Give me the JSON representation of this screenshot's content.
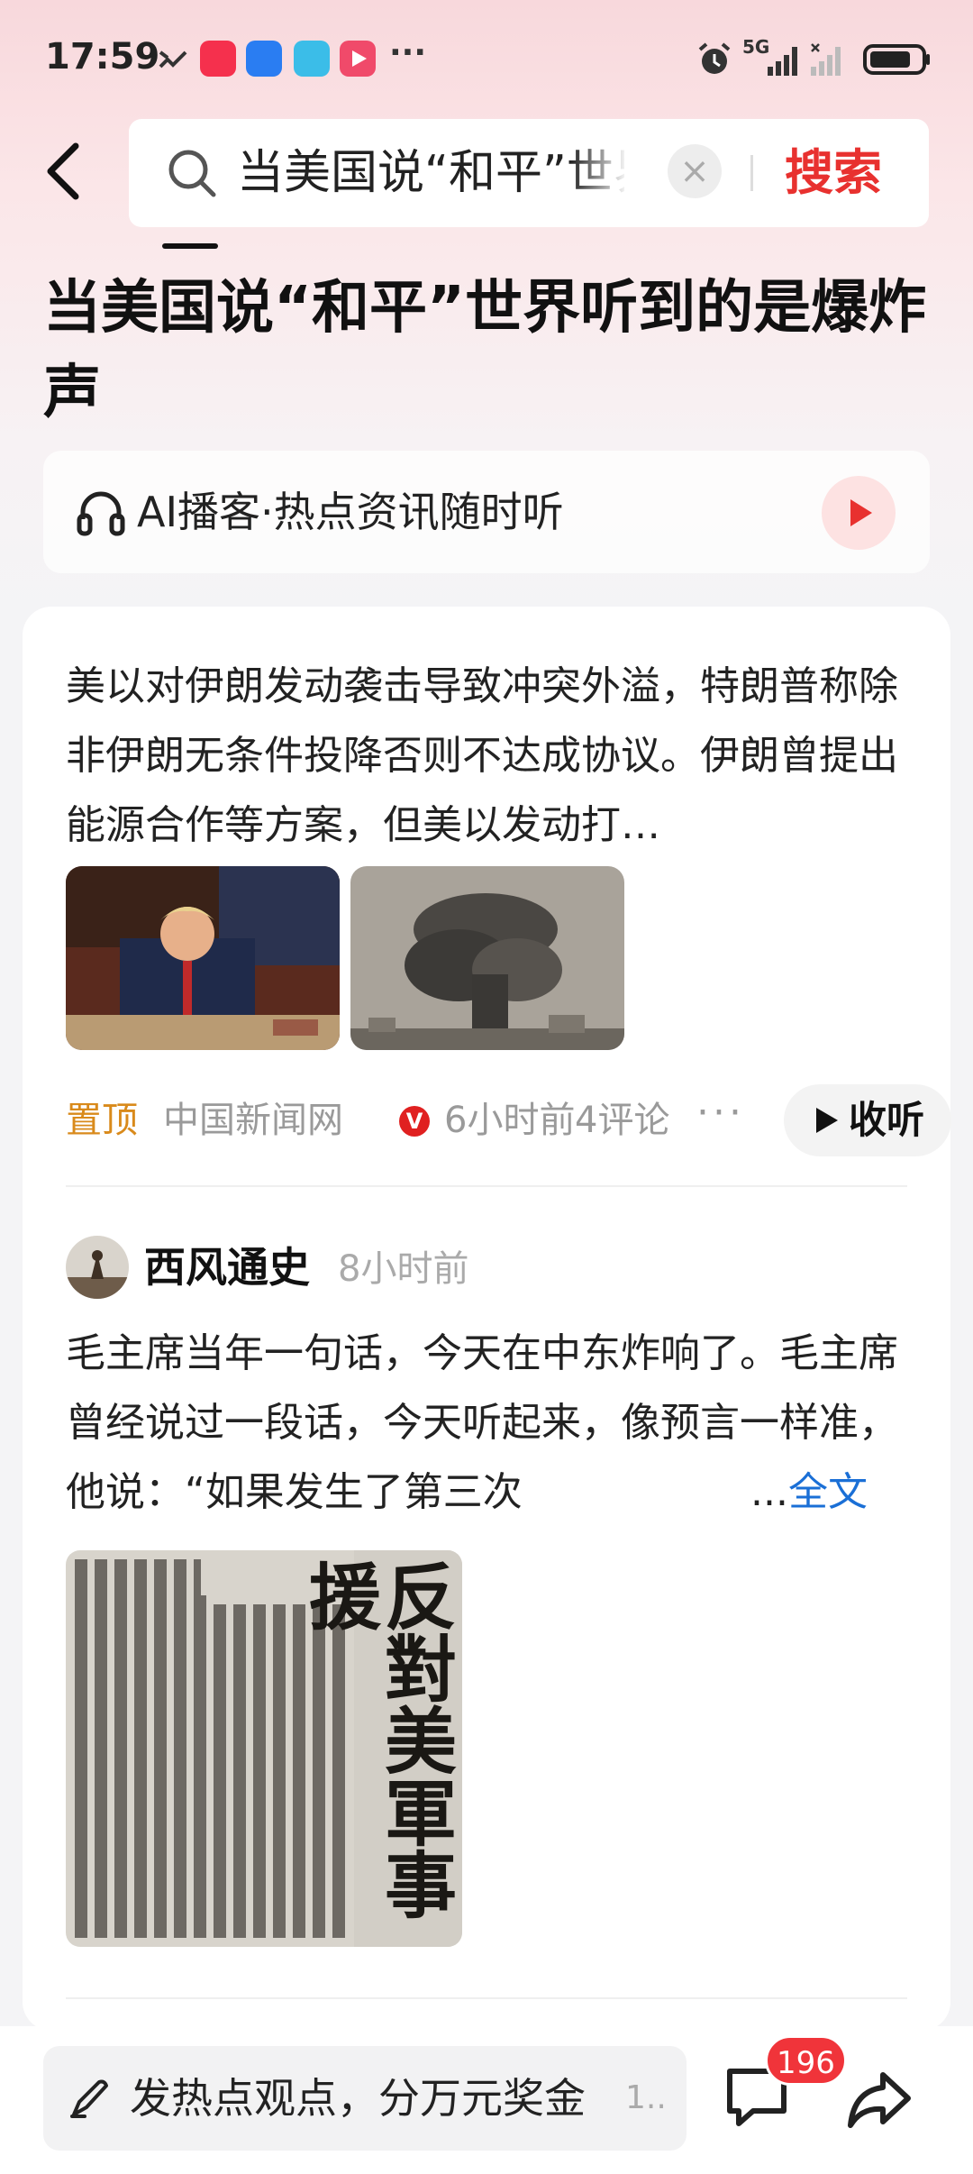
{
  "status_bar": {
    "time": "17:59",
    "more": "···",
    "network": "5G",
    "icons": [
      "missed-call-icon",
      "app-icon-red",
      "app-icon-car",
      "app-icon-book",
      "app-icon-video",
      "alarm-icon",
      "signal-icon",
      "battery-icon"
    ]
  },
  "search": {
    "query": "当美国说“和平”世界听到的是爆炸声",
    "submit_label": "搜索"
  },
  "article": {
    "title": "当美国说“和平”世界听到的是爆炸声"
  },
  "podcast": {
    "label": "AI播客·热点资讯随时听"
  },
  "news_item": {
    "summary": "美以对伊朗发动袭击导致冲突外溢，特朗普称除非伊朗无条件投降否则不达成协议。伊朗曾提出能源合作等方案，但美以发动打…",
    "pin_label": "置顶",
    "source": "中国新闻网",
    "verified_mark": "V",
    "time": "6小时前",
    "comments": "4评论",
    "more": "···",
    "listen_label": "收听"
  },
  "post": {
    "author": "西风通史",
    "time": "8小时前",
    "text": "毛主席当年一句话，今天在中东炸响了。毛主席曾经说过一段话，今天听起来，像预言一样准，他说：“如果发生了第三次",
    "ellipsis": "...",
    "fulltext_label": "全文",
    "image_headline": "反對美軍事援"
  },
  "bottom_bar": {
    "comment_placeholder": "发热点观点，分万元奖金",
    "comment_suffix": "1..",
    "comment_count": "196"
  },
  "colors": {
    "accent_red": "#e8312f",
    "pin_orange": "#d98a1b",
    "link_blue": "#1a6fd6",
    "badge_red": "#f0343a"
  }
}
